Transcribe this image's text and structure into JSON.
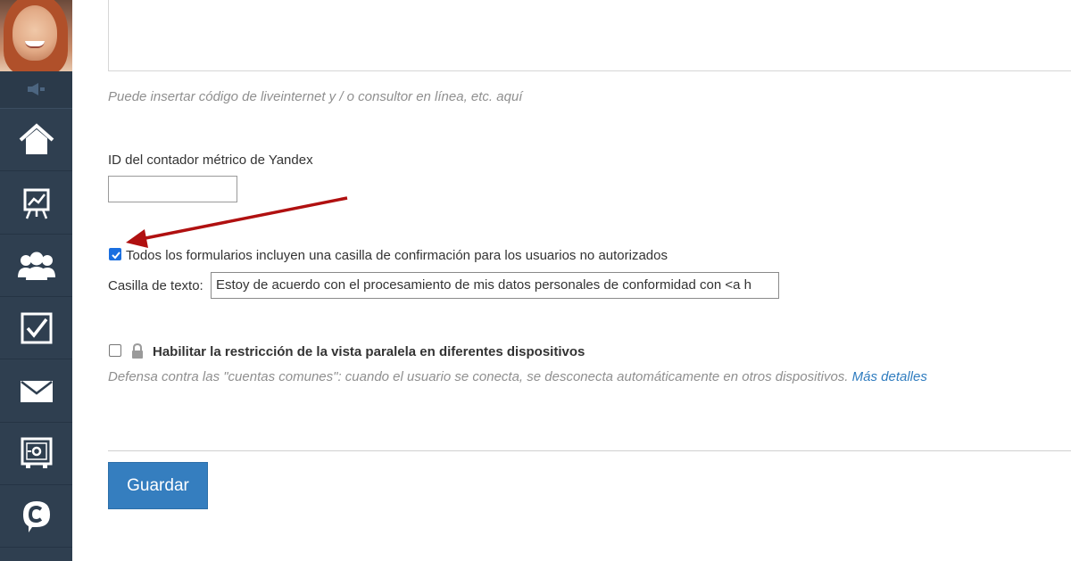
{
  "sidebar": {
    "items": [
      {
        "icon": "home-icon"
      },
      {
        "icon": "chart-board-icon"
      },
      {
        "icon": "users-icon"
      },
      {
        "icon": "checkbox-icon"
      },
      {
        "icon": "mail-icon"
      },
      {
        "icon": "safe-settings-icon"
      },
      {
        "icon": "chat-c-icon"
      }
    ]
  },
  "form": {
    "code_hint": "Puede insertar código de liveinternet y / o consultor en línea, etc. aquí",
    "yandex_label": "ID del contador métrico de Yandex",
    "yandex_value": "",
    "consent_checkbox_label": "Todos los formularios incluyen una casilla de confirmación para los usuarios no autorizados",
    "consent_checked": true,
    "text_field_label": "Casilla de texto:",
    "text_field_value": "Estoy de acuerdo con el procesamiento de mis datos personales de conformidad con <a h",
    "parallel_checkbox_label": "Habilitar la restricción de la vista paralela en diferentes dispositivos",
    "parallel_checked": false,
    "parallel_hint": "Defensa contra las \"cuentas comunes\": cuando el usuario se conecta, se desconecta automáticamente en otros dispositivos.",
    "more_details_link": "Más detalles",
    "save_label": "Guardar"
  },
  "colors": {
    "sidebar_bg": "#2f3f50",
    "accent": "#357ebf",
    "arrow": "#b01010",
    "link": "#2f7cbf"
  }
}
